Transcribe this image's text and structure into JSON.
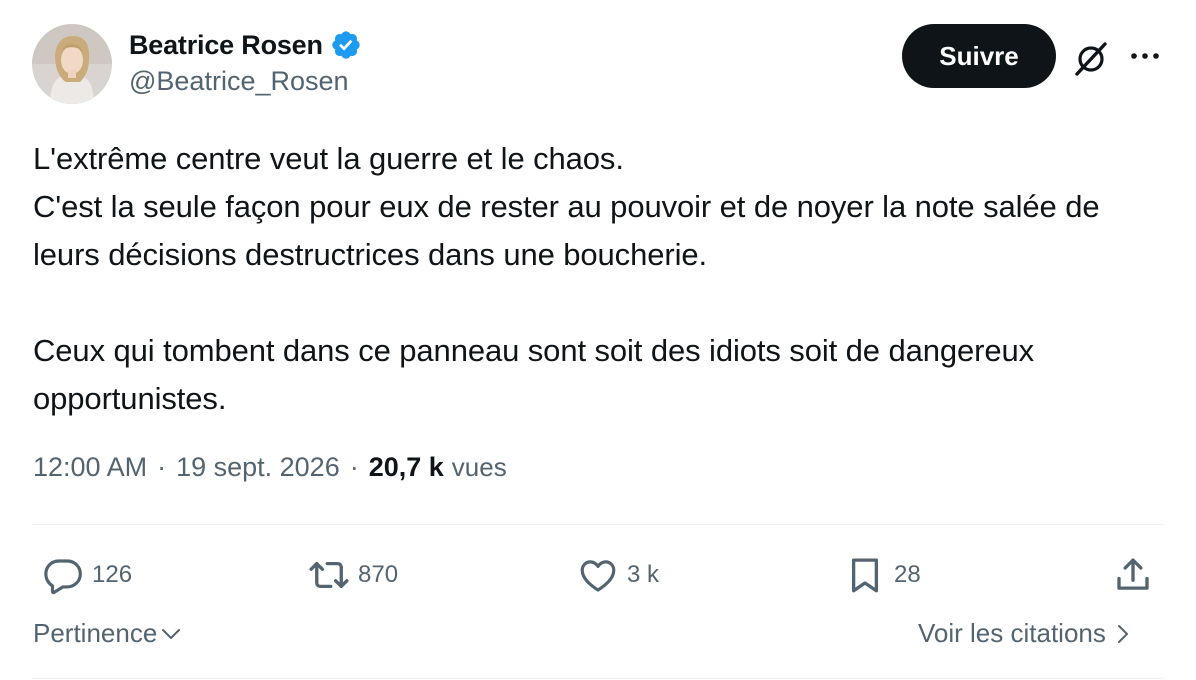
{
  "author": {
    "display_name": "Beatrice Rosen",
    "handle": "@Beatrice_Rosen",
    "verified": true,
    "verified_color": "#1d9bf0"
  },
  "header": {
    "follow_label": "Suivre",
    "grok_icon": "grok-icon",
    "more_icon": "more-horizontal-icon"
  },
  "tweet": {
    "text": "L'extrême centre veut la guerre et le chaos.\nC'est la seule façon pour eux de rester au pouvoir et de noyer la note salée de leurs décisions destructrices dans une boucherie.\n\nCeux qui tombent dans ce panneau sont soit des idiots soit de dangereux opportunistes.",
    "time": "12:00 AM",
    "date": "19 sept. 2026",
    "views_count": "20,7 k",
    "views_label": "vues"
  },
  "actions": {
    "replies": "126",
    "reposts": "870",
    "likes": "3 k",
    "bookmarks": "28"
  },
  "footer": {
    "sort_label": "Pertinence",
    "quotes_label": "Voir les citations"
  },
  "colors": {
    "text": "#0f1419",
    "secondary": "#536471",
    "divider": "#eff3f4",
    "button_bg": "#0f1419"
  }
}
